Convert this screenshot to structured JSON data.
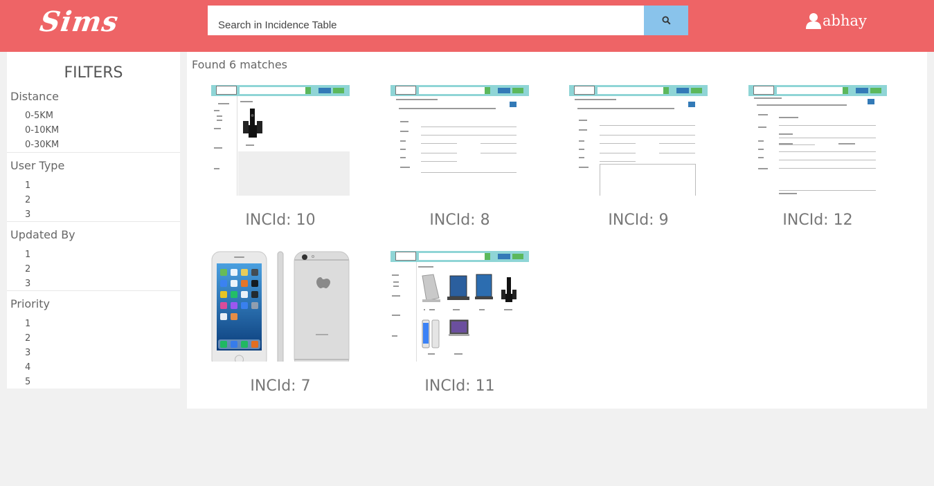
{
  "header": {
    "logo": "Sims",
    "search_placeholder": "Search in Incidence Table",
    "search_icon": "search-icon",
    "username": "abhay",
    "user_icon": "user-icon"
  },
  "sidebar": {
    "title": "FILTERS",
    "groups": [
      {
        "title": "Distance",
        "options": [
          "0-5KM",
          "0-10KM",
          "0-30KM"
        ]
      },
      {
        "title": "User Type",
        "options": [
          "1",
          "2",
          "3"
        ]
      },
      {
        "title": "Updated By",
        "options": [
          "1",
          "2",
          "3"
        ]
      },
      {
        "title": "Priority",
        "options": [
          "1",
          "2",
          "3",
          "4",
          "5"
        ]
      }
    ]
  },
  "results": {
    "summary": "Found 6 matches",
    "items": [
      {
        "label": "INCId: 10",
        "thumbnail": "speaker-set-screenshot"
      },
      {
        "label": "INCId: 8",
        "thumbnail": "incident-form-screenshot"
      },
      {
        "label": "INCId: 9",
        "thumbnail": "incident-form-screenshot"
      },
      {
        "label": "INCId: 12",
        "thumbnail": "incident-detail-screenshot"
      },
      {
        "label": "INCId: 7",
        "thumbnail": "iphone-photo"
      },
      {
        "label": "INCId: 11",
        "thumbnail": "product-grid-screenshot"
      }
    ]
  },
  "colors": {
    "header": "#ee6466",
    "search_button": "#89c3eb",
    "page_background": "#f1f1f1"
  }
}
